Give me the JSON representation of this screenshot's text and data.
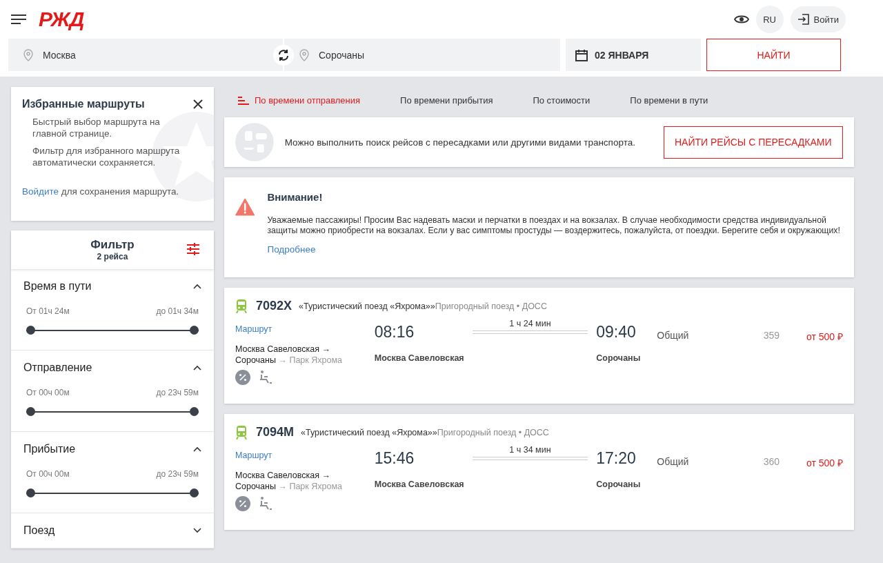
{
  "header": {
    "logo": "РЖД",
    "language": "RU",
    "login": "Войти"
  },
  "search": {
    "from": "Москва",
    "to": "Сорочаны",
    "date": "02 ЯНВАРЯ",
    "submit": "НАЙТИ"
  },
  "favorites": {
    "title": "Избранные маршруты",
    "lines": [
      "Быстрый выбор маршрута на главной странице.",
      "Фильтр для избранного маршрута автоматически сохраняется."
    ],
    "login_link": "Войдите",
    "login_text": "для сохранения маршрута."
  },
  "filter": {
    "title": "Фильтр",
    "count": "2 рейса",
    "sections": [
      {
        "title": "Время в пути",
        "expanded": true,
        "from": "От 01ч 24м",
        "to": "до 01ч 34м",
        "thumbs": [
          {
            "level": 0
          },
          {
            "level": 1
          }
        ]
      },
      {
        "title": "Отправление",
        "expanded": true,
        "from": "От 00ч 00м",
        "to": "до 23ч 59м",
        "thumbs": [
          {
            "level": 0
          },
          {
            "level": 1
          }
        ]
      },
      {
        "title": "Прибытие",
        "expanded": true,
        "from": "От 00ч 00м",
        "to": "до 23ч 59м",
        "thumbs": [
          {
            "level": 0
          },
          {
            "level": 1
          }
        ]
      },
      {
        "title": "Поезд",
        "expanded": false
      }
    ]
  },
  "sort_tabs": [
    {
      "label": "По времени отправления",
      "selected": true
    },
    {
      "label": "По времени прибытия",
      "selected": false
    },
    {
      "label": "По стоимости",
      "selected": false
    },
    {
      "label": "По времени в пути",
      "selected": false
    }
  ],
  "transfer_banner": {
    "text": "Можно выполнить поиск рейсов с пересадками или другими видами транспорта.",
    "button": "НАЙТИ РЕЙСЫ С ПЕРЕСАДКАМИ"
  },
  "notice": {
    "title": "Внимание!",
    "text": "Уважаемые пассажиры! Просим Вас надевать маски и перчатки в поездах и на вокзалах. В случае необходимости средства индивидуальной защиты можно приобрести на вокзалах. Если у вас симптомы простуды — воздержитесь, пожалуйста, от поездки. Берегите себя и окружающих!",
    "link": "Подробнее"
  },
  "trains": [
    {
      "number": "7092Х",
      "name": "«Туристический поезд «Яхрома»»",
      "type": "Пригородный поезд • ДОСС",
      "route_link": "Маршрут",
      "route_from": "Москва Савеловская →",
      "route_to": "Сорочаны",
      "route_end": "→ Парк Яхрома",
      "departure": "08:16",
      "duration": "1 ч 24 мин",
      "arrival": "09:40",
      "departure_station": "Москва Савеловская",
      "arrival_station": "Сорочаны",
      "car_class": "Общий",
      "seats": "359",
      "price": "от 500 ₽"
    },
    {
      "number": "7094М",
      "name": "«Туристический поезд «Яхрома»»",
      "type": "Пригородный поезд • ДОСС",
      "route_link": "Маршрут",
      "route_from": "Москва Савеловская →",
      "route_to": "Сорочаны",
      "route_end": "→ Парк Яхрома",
      "departure": "15:46",
      "duration": "1 ч 34 мин",
      "arrival": "17:20",
      "departure_station": "Москва Савеловская",
      "arrival_station": "Сорочаны",
      "car_class": "Общий",
      "seats": "360",
      "price": "от 500 ₽"
    }
  ]
}
